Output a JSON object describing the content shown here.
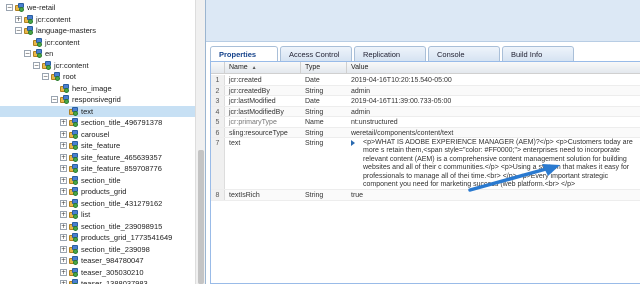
{
  "tree": {
    "items": [
      {
        "label": "we-retail",
        "depth": 0,
        "expander": "−",
        "icon": "folder-node-icon"
      },
      {
        "label": "jcr:content",
        "depth": 1,
        "expander": "+",
        "icon": "content-node-icon"
      },
      {
        "label": "language-masters",
        "depth": 1,
        "expander": "−",
        "icon": "page-node-icon"
      },
      {
        "label": "jcr:content",
        "depth": 2,
        "expander": "",
        "icon": "content-node-icon"
      },
      {
        "label": "en",
        "depth": 2,
        "expander": "−",
        "icon": "page-node-icon"
      },
      {
        "label": "jcr:content",
        "depth": 3,
        "expander": "−",
        "icon": "content-node-icon"
      },
      {
        "label": "root",
        "depth": 4,
        "expander": "−",
        "icon": "component-node-icon"
      },
      {
        "label": "hero_image",
        "depth": 5,
        "expander": "",
        "icon": "component-node-icon"
      },
      {
        "label": "responsivegrid",
        "depth": 5,
        "expander": "−",
        "icon": "component-node-icon"
      },
      {
        "label": "text",
        "depth": 6,
        "expander": "",
        "icon": "component-node-icon",
        "selected": true
      },
      {
        "label": "section_title_496791378",
        "depth": 6,
        "expander": "+",
        "icon": "component-node-icon"
      },
      {
        "label": "carousel",
        "depth": 6,
        "expander": "+",
        "icon": "component-node-icon"
      },
      {
        "label": "site_feature",
        "depth": 6,
        "expander": "+",
        "icon": "component-node-icon"
      },
      {
        "label": "site_feature_465639357",
        "depth": 6,
        "expander": "+",
        "icon": "component-node-icon"
      },
      {
        "label": "site_feature_859708776",
        "depth": 6,
        "expander": "+",
        "icon": "component-node-icon"
      },
      {
        "label": "section_title",
        "depth": 6,
        "expander": "+",
        "icon": "component-node-icon"
      },
      {
        "label": "products_grid",
        "depth": 6,
        "expander": "+",
        "icon": "component-node-icon"
      },
      {
        "label": "section_title_431279162",
        "depth": 6,
        "expander": "+",
        "icon": "component-node-icon"
      },
      {
        "label": "list",
        "depth": 6,
        "expander": "+",
        "icon": "component-node-icon"
      },
      {
        "label": "section_title_239098915",
        "depth": 6,
        "expander": "+",
        "icon": "component-node-icon"
      },
      {
        "label": "products_grid_1773541649",
        "depth": 6,
        "expander": "+",
        "icon": "component-node-icon"
      },
      {
        "label": "section_title_239098",
        "depth": 6,
        "expander": "+",
        "icon": "component-node-icon"
      },
      {
        "label": "teaser_984780047",
        "depth": 6,
        "expander": "+",
        "icon": "component-node-icon"
      },
      {
        "label": "teaser_305030210",
        "depth": 6,
        "expander": "+",
        "icon": "component-node-icon"
      },
      {
        "label": "teaser_1388037983",
        "depth": 6,
        "expander": "+",
        "icon": "component-node-icon"
      }
    ]
  },
  "tabs": [
    "Properties",
    "Access Control",
    "Replication",
    "Console",
    "Build Info"
  ],
  "grid": {
    "headers": [
      "Name",
      "Type",
      "Value"
    ],
    "sort_indicator": "▲",
    "rows": [
      {
        "num": "1",
        "name": "jcr:created",
        "type": "Date",
        "value": "2019-04-16T10:20:15.540-05:00",
        "dim": false
      },
      {
        "num": "2",
        "name": "jcr:createdBy",
        "type": "String",
        "value": "admin",
        "dim": false
      },
      {
        "num": "3",
        "name": "jcr:lastModified",
        "type": "Date",
        "value": "2019-04-16T11:39:00.733-05:00",
        "dim": false
      },
      {
        "num": "4",
        "name": "jcr:lastModifiedBy",
        "type": "String",
        "value": "admin",
        "dim": false
      },
      {
        "num": "5",
        "name": "jcr:primaryType",
        "type": "Name",
        "value": "nt:unstructured",
        "dim": true
      },
      {
        "num": "6",
        "name": "sling:resourceType",
        "type": "String",
        "value": "weretail/components/content/text",
        "dim": false
      },
      {
        "num": "7",
        "name": "text",
        "type": "String",
        "value": "<p>WHAT IS ADOBE EXPERIENCE MANAGER (AEM)?</p> <p>Customers today are more s retain them,<span style=\"color: #FF0000;\"> enterprises need to incorporate relevant content (AEM) is a comprehensive content management solution for building websites and all of their c communities.</p> <p>Using a system that makes it easy for professionals to manage all of thei time.<br> </p> <p>Every important strategic component you need for marketing success (web platform.<br> </p>",
        "dim": false
      },
      {
        "num": "8",
        "name": "textIsRich",
        "type": "String",
        "value": "true",
        "dim": false
      }
    ]
  },
  "colors": {
    "accent": "#2a7ad0",
    "selected_row": "#c7e0f4",
    "header_band": "#dce8f5"
  }
}
